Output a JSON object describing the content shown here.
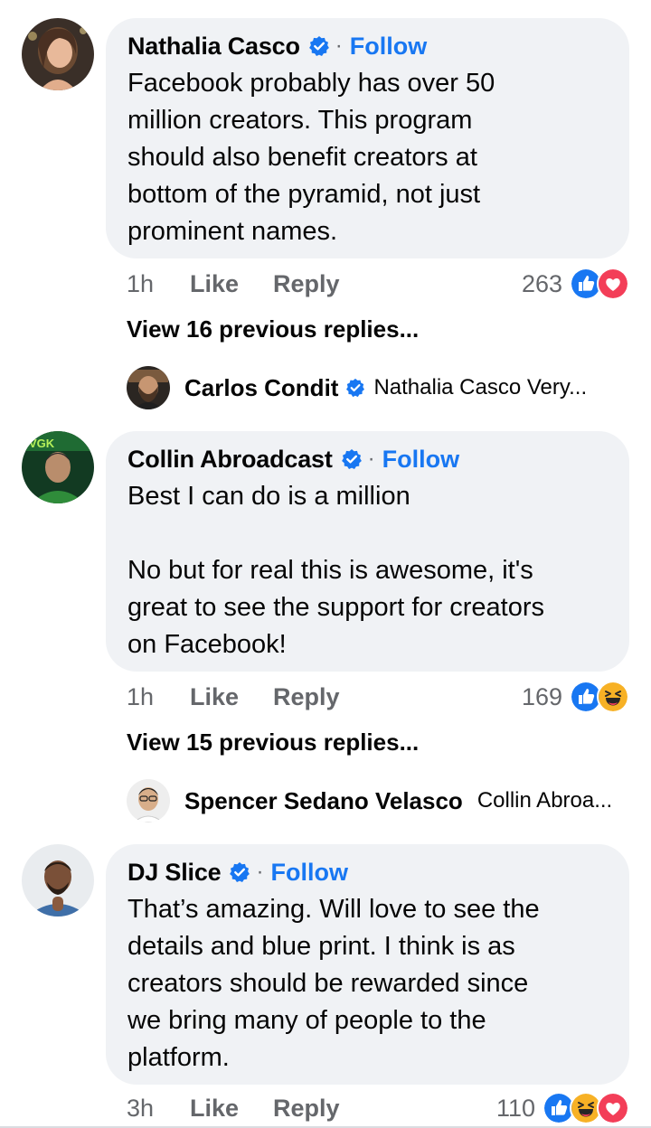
{
  "colors": {
    "follow": "#1877f2",
    "bubble": "#f0f2f5",
    "meta": "#65676b",
    "like_react": "#1877f2",
    "love_react": "#f33e58",
    "haha_react": "#f7b125"
  },
  "comments": [
    {
      "name": "Nathalia Casco",
      "verified": true,
      "follow_label": "Follow",
      "text": "Facebook probably has over 50\nmillion creators. This program\nshould also benefit creators at\nbottom of the pyramid, not just\nprominent names.",
      "time": "1h",
      "like_label": "Like",
      "reply_label": "Reply",
      "reaction_count": "263",
      "reactions": [
        "like-icon",
        "love-icon"
      ],
      "view_previous": "View 16 previous replies...",
      "latest_reply": {
        "name": "Carlos Condit",
        "snippet": "Nathalia Casco Very..."
      }
    },
    {
      "name": "Collin Abroadcast",
      "verified": true,
      "follow_label": "Follow",
      "text": "Best I can do is a million\n\nNo but for real this is awesome, it's\ngreat to see the support for creators\non Facebook!",
      "time": "1h",
      "like_label": "Like",
      "reply_label": "Reply",
      "reaction_count": "169",
      "reactions": [
        "like-icon",
        "haha-icon"
      ],
      "view_previous": "View 15 previous replies...",
      "latest_reply": {
        "name": "Spencer Sedano Velasco",
        "snippet": "Collin Abroa..."
      }
    },
    {
      "name": "DJ Slice",
      "verified": true,
      "follow_label": "Follow",
      "text": "That’s amazing. Will love to see the\ndetails and blue print. I think is as\ncreators should be rewarded since\nwe bring many of people to the\nplatform.",
      "time": "3h",
      "like_label": "Like",
      "reply_label": "Reply",
      "reaction_count": "110",
      "reactions": [
        "like-icon",
        "haha-icon",
        "love-icon"
      ]
    }
  ]
}
